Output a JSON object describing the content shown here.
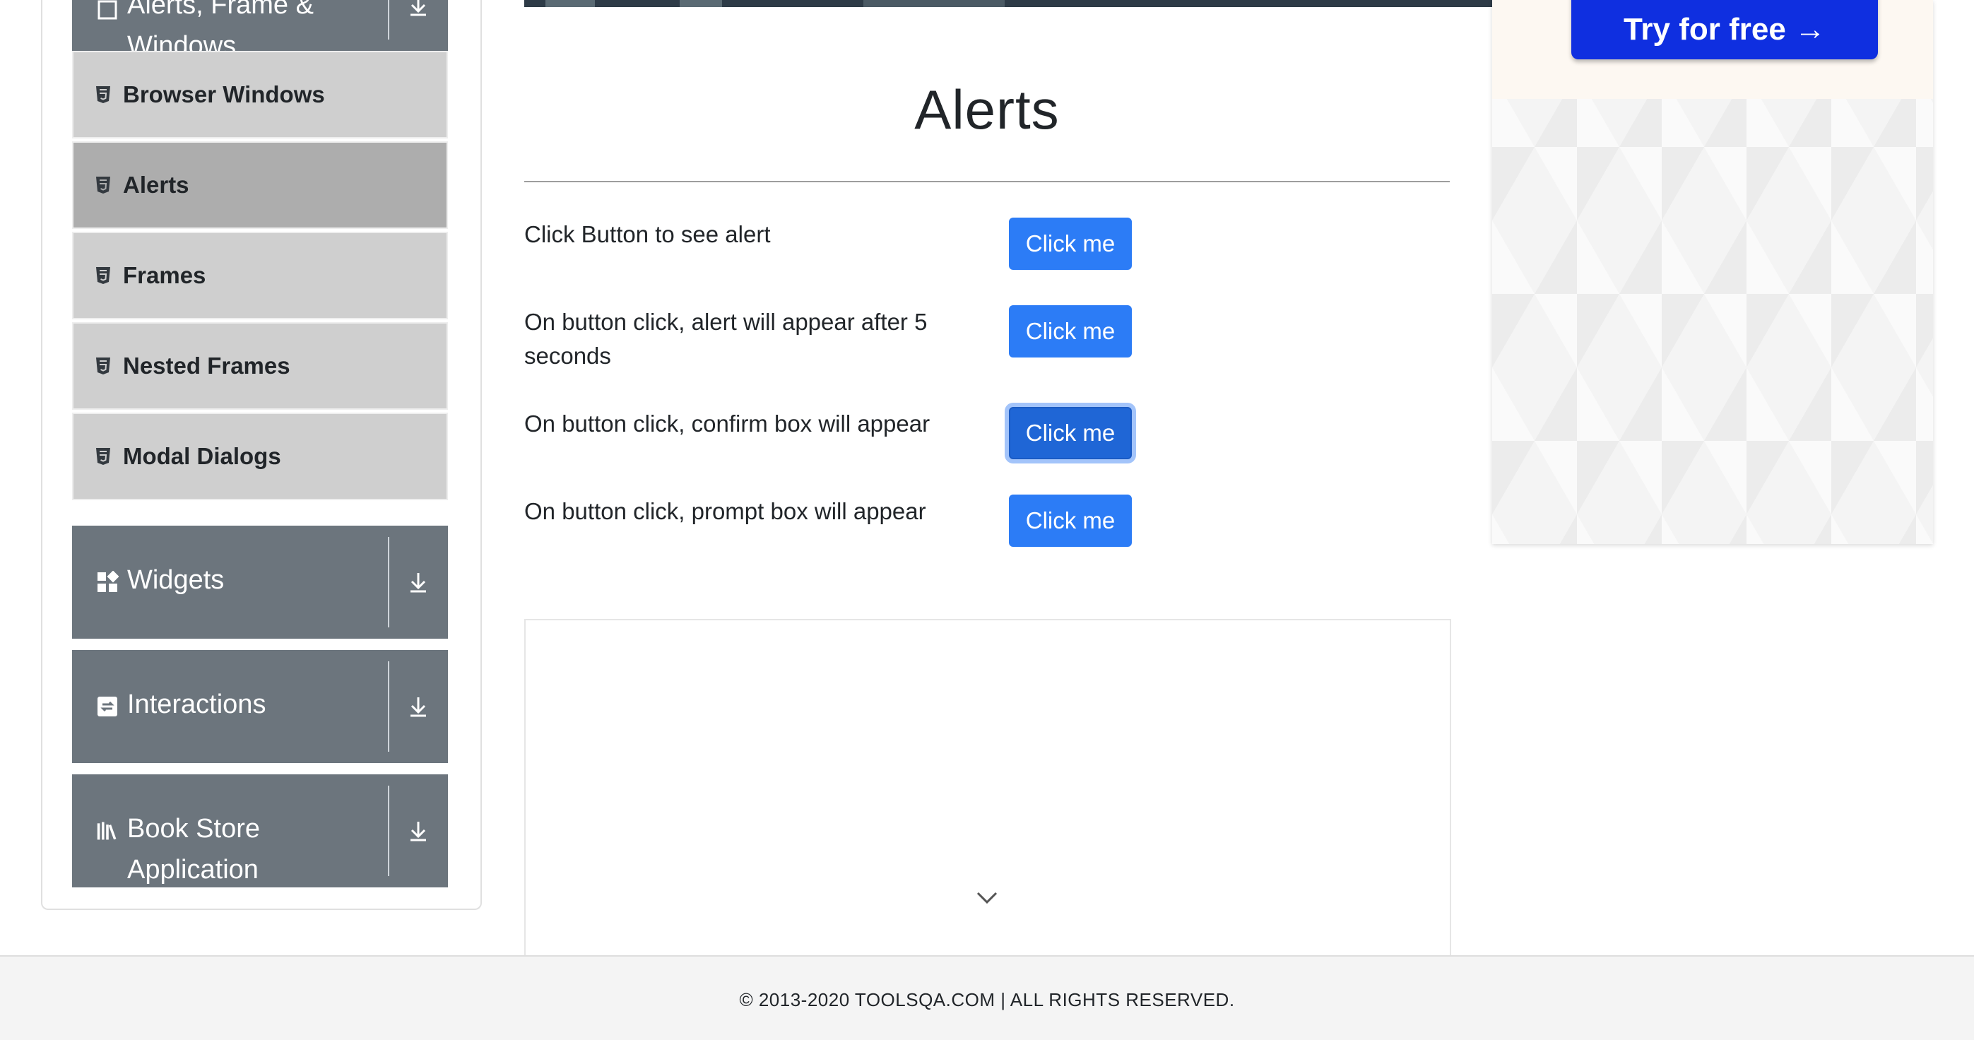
{
  "sidebar": {
    "group_alerts_title": "Alerts, Frame & Windows",
    "items": [
      {
        "label": "Browser Windows",
        "icon": "html5-icon"
      },
      {
        "label": "Alerts",
        "icon": "html5-icon",
        "active": true
      },
      {
        "label": "Frames",
        "icon": "html5-icon"
      },
      {
        "label": "Nested Frames",
        "icon": "html5-icon"
      },
      {
        "label": "Modal Dialogs",
        "icon": "html5-icon"
      }
    ],
    "groups": [
      {
        "title": "Widgets",
        "icon": "widgets-icon"
      },
      {
        "title": "Interactions",
        "icon": "interactions-icon"
      },
      {
        "title": "Book Store Application",
        "icon": "bookstore-icon"
      }
    ]
  },
  "main": {
    "title": "Alerts",
    "rows": [
      {
        "text": "Click Button to see alert",
        "button": "Click me"
      },
      {
        "text": "On button click, alert will appear after 5 seconds",
        "button": "Click me"
      },
      {
        "text": "On button click, confirm box will appear",
        "button": "Click me",
        "focused": true
      },
      {
        "text": "On button click, prompt box will appear",
        "button": "Click me"
      }
    ]
  },
  "ad": {
    "cta_label": "Try for free →"
  },
  "footer": {
    "text": "© 2013-2020 TOOLSQA.COM | ALL RIGHTS RESERVED."
  },
  "colors": {
    "primary_button": "#2c7cf6",
    "sidebar_group": "#6c757d",
    "menu_item": "#cfcfcf",
    "menu_item_active": "#adadad",
    "cta": "#0f2fe0"
  }
}
